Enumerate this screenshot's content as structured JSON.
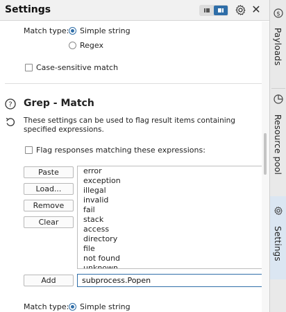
{
  "header": {
    "title": "Settings"
  },
  "rail": {
    "tabs": [
      {
        "label": "Payloads",
        "icon": "dollar-icon"
      },
      {
        "label": "Resource pool",
        "icon": "pie-chart-icon"
      },
      {
        "label": "Settings",
        "icon": "gear-icon"
      }
    ],
    "active": "Settings"
  },
  "match_type_top": {
    "label": "Match type:",
    "options": [
      "Simple string",
      "Regex"
    ],
    "selected": "Simple string"
  },
  "case_sensitive": {
    "label": "Case-sensitive match",
    "checked": false
  },
  "grep_match": {
    "title": "Grep - Match",
    "description": "These settings can be used to flag result items containing specified expressions.",
    "flag_label": "Flag responses matching these expressions:",
    "flag_checked": false,
    "buttons": {
      "paste": "Paste",
      "load": "Load...",
      "remove": "Remove",
      "clear": "Clear",
      "add": "Add"
    },
    "items": [
      "error",
      "exception",
      "illegal",
      "invalid",
      "fail",
      "stack",
      "access",
      "directory",
      "file",
      "not found",
      "unknown"
    ],
    "add_value": "subprocess.Popen",
    "match_type_label": "Match type:",
    "match_type_value": "Simple string"
  },
  "colors": {
    "accent": "#2f6ea8",
    "rail_active": "#dbe6f2"
  }
}
